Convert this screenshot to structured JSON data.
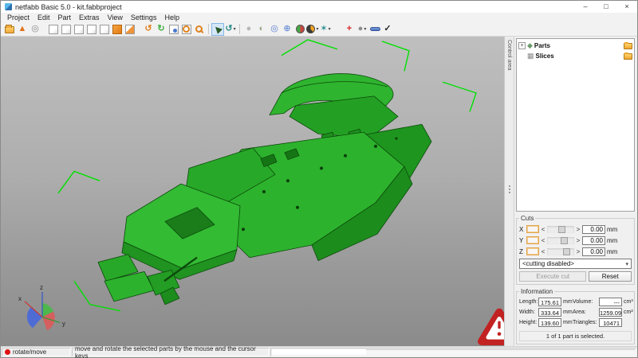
{
  "window": {
    "title": "netfabb Basic 5.0 - kit.fabbproject",
    "controls": {
      "minimize": "–",
      "maximize": "□",
      "close": "×"
    }
  },
  "menu": {
    "items": [
      {
        "label": "Project"
      },
      {
        "label": "Edit"
      },
      {
        "label": "Part"
      },
      {
        "label": "Extras"
      },
      {
        "label": "View"
      },
      {
        "label": "Settings"
      },
      {
        "label": "Help"
      }
    ]
  },
  "toolbar": {
    "dropdown_glyph": "▾",
    "icons": [
      {
        "name": "open-project-icon",
        "glyph": ""
      },
      {
        "name": "import-part-icon",
        "glyph": "▲"
      },
      {
        "name": "settings-icon",
        "glyph": "◎"
      },
      {
        "name": "view-cube-default-icon",
        "glyph": ""
      },
      {
        "name": "view-cube-top-icon",
        "glyph": ""
      },
      {
        "name": "view-cube-bottom-icon",
        "glyph": ""
      },
      {
        "name": "view-cube-front-icon",
        "glyph": ""
      },
      {
        "name": "view-cube-back-icon",
        "glyph": ""
      },
      {
        "name": "view-cube-left-icon",
        "glyph": ""
      },
      {
        "name": "view-cube-right-icon",
        "glyph": ""
      },
      {
        "name": "zoom-out-icon",
        "glyph": "↺"
      },
      {
        "name": "zoom-in-icon",
        "glyph": "↻"
      },
      {
        "name": "fit-view-icon",
        "glyph": ""
      },
      {
        "name": "zoom-selection-icon",
        "glyph": ""
      },
      {
        "name": "magnifier-icon",
        "glyph": ""
      },
      {
        "name": "select-tool-icon",
        "glyph": "▶"
      },
      {
        "name": "rotate-tool-icon",
        "glyph": "↺"
      },
      {
        "name": "single-shell-icon",
        "glyph": "●"
      },
      {
        "name": "shells-icon",
        "glyph": "◐"
      },
      {
        "name": "move-parts-icon",
        "glyph": "◎"
      },
      {
        "name": "wireframe-icon",
        "glyph": "⊕"
      },
      {
        "name": "slices-view-icon",
        "glyph": ""
      },
      {
        "name": "analysis-icon",
        "glyph": ""
      },
      {
        "name": "highlight-icon",
        "glyph": "✶"
      },
      {
        "name": "repair-icon",
        "glyph": "+"
      },
      {
        "name": "auto-repair-icon",
        "glyph": "●"
      },
      {
        "name": "measure-icon",
        "glyph": ""
      },
      {
        "name": "apply-icon",
        "glyph": "✓"
      }
    ]
  },
  "control_area": {
    "tab_label": "Control area",
    "tree": {
      "expander_glyph": "+",
      "items": [
        {
          "label": "Parts",
          "icon_glyph": "◆"
        },
        {
          "label": "Slices",
          "icon_glyph": "▦"
        }
      ]
    },
    "cuts": {
      "title": "Cuts",
      "dec_glyph": "<",
      "inc_glyph": ">",
      "axes": [
        {
          "label": "X",
          "value": "0.00",
          "unit": "mm"
        },
        {
          "label": "Y",
          "value": "0.00",
          "unit": "mm"
        },
        {
          "label": "Z",
          "value": "0.00",
          "unit": "mm"
        }
      ],
      "mode_dropdown": {
        "value": "<cutting disabled>",
        "chevron": "▾"
      },
      "execute_button": "Execute cut",
      "reset_button": "Reset"
    },
    "information": {
      "title": "Information",
      "rows": [
        {
          "label": "Length:",
          "value": "175.61",
          "unit": "mm",
          "label2": "Volume:",
          "value2": "---",
          "unit2": "cm³"
        },
        {
          "label": "Width:",
          "value": "333.64",
          "unit": "mm",
          "label2": "Area:",
          "value2": "1259.09",
          "unit2": "cm²"
        },
        {
          "label": "Height:",
          "value": "139.60",
          "unit": "mm",
          "label2": "Triangles:",
          "value2": "10471",
          "unit2": ""
        }
      ],
      "selection_status": "1 of 1 part is selected."
    }
  },
  "viewport": {
    "axes": {
      "x": "x",
      "y": "y",
      "z": "z"
    },
    "selection_color": "#00e000",
    "model_color": "#2db22d",
    "warning_color": "#cc2222"
  },
  "statusbar": {
    "mode": "rotate/move",
    "hint": "move and rotate the selected parts by the mouse and the cursor keys"
  }
}
